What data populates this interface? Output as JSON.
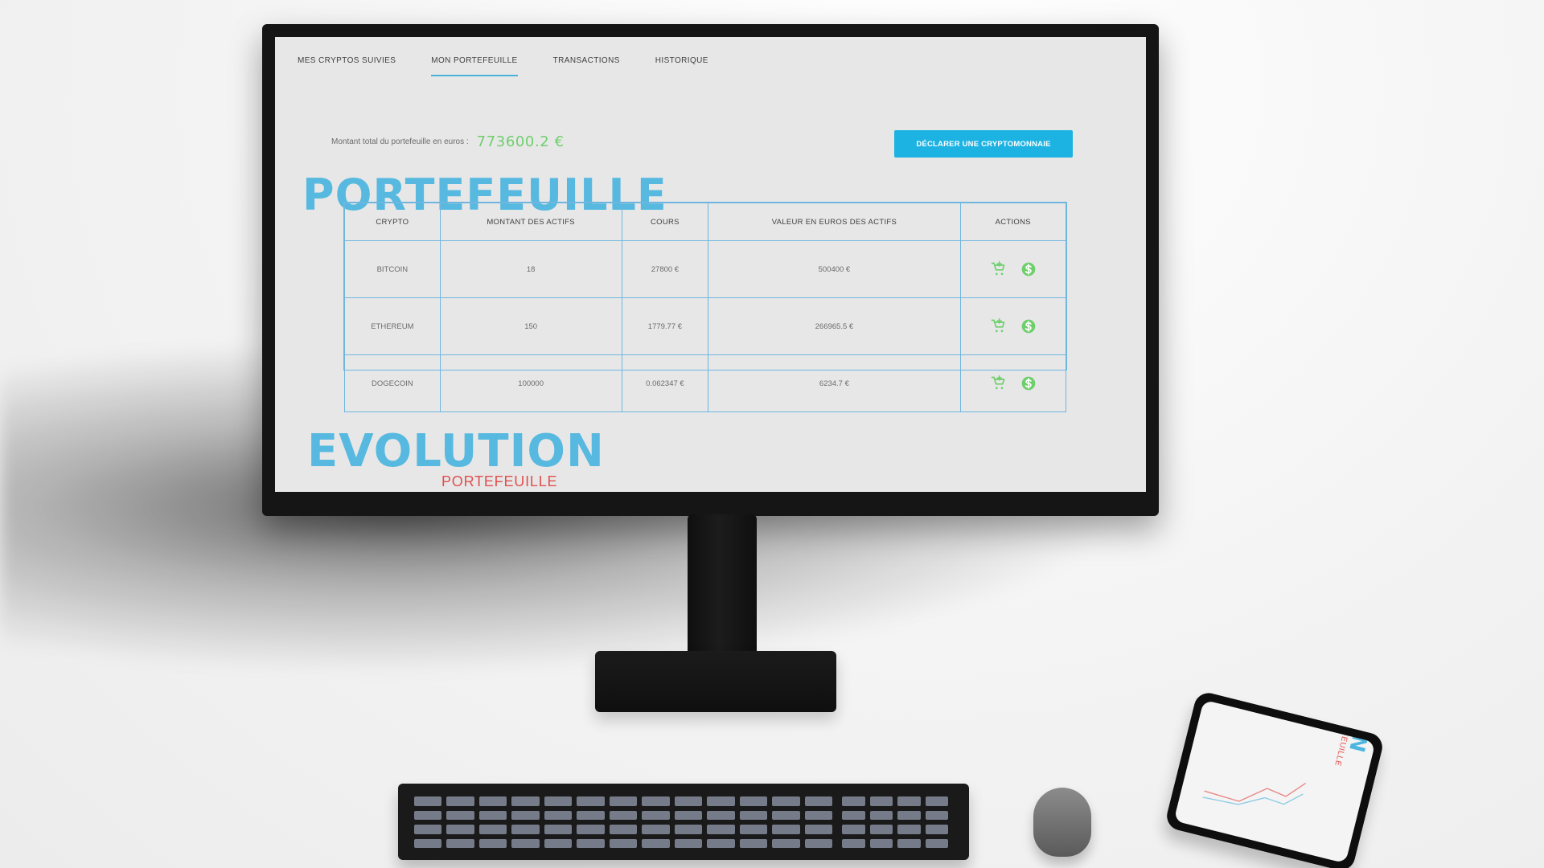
{
  "nav": {
    "tabs": [
      {
        "label": "MES CRYPTOS SUIVIES"
      },
      {
        "label": "MON PORTEFEUILLE"
      },
      {
        "label": "TRANSACTIONS"
      },
      {
        "label": "HISTORIQUE"
      }
    ],
    "active_index": 1
  },
  "summary": {
    "label": "Montant total du portefeuille en euros :",
    "value": "773600.2 €",
    "value_color": "#6fcf6c"
  },
  "actions": {
    "declare_label": "DÉCLARER UNE CRYPTOMONNAIE",
    "accent": "#1cb3e3"
  },
  "sections": {
    "portfolio_title": "PORTEFEUILLE",
    "evolution_title": "EVOLUTION",
    "evolution_subtitle": "PORTEFEUILLE",
    "title_color": "#57b9df",
    "subtitle_color": "#e0504e"
  },
  "table": {
    "headers": [
      "CRYPTO",
      "MONTANT DES ACTIFS",
      "COURS",
      "VALEUR EN EUROS DES ACTIFS",
      "ACTIONS"
    ],
    "rows": [
      {
        "crypto": "BITCOIN",
        "amount": "18",
        "price": "27800 €",
        "value": "500400 €"
      },
      {
        "crypto": "ETHEREUM",
        "amount": "150",
        "price": "1779.77 €",
        "value": "266965.5 €"
      },
      {
        "crypto": "DOGECOIN",
        "amount": "100000",
        "price": "0.062347 €",
        "value": "6234.7 €"
      }
    ],
    "icons": {
      "buy": "cart-plus-icon",
      "sell": "dollar-coin-icon"
    },
    "icon_color": "#6fcf6c",
    "border_color": "#6fb6df"
  },
  "phone": {
    "title": "EVOLUTION",
    "subtitle": "PORTEFEUILLE"
  }
}
